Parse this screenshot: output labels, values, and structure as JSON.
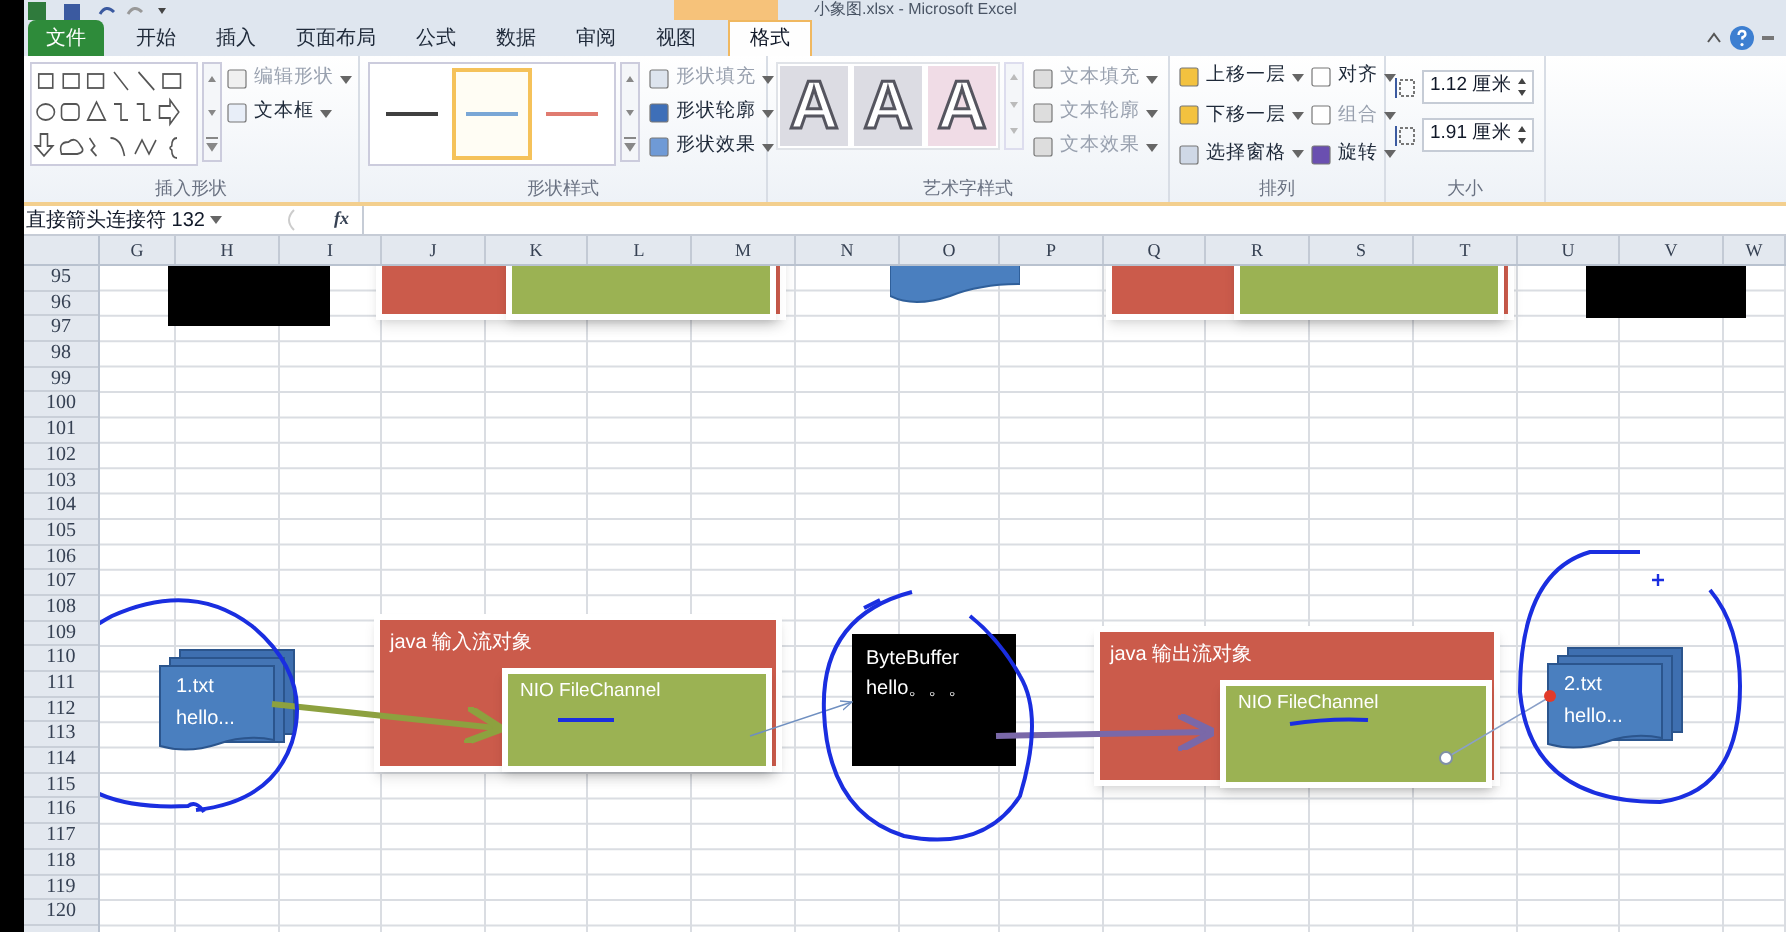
{
  "window": {
    "title": "小象图.xlsx - Microsoft Excel"
  },
  "tabs": [
    {
      "label": "文件",
      "kind": "file",
      "selected": false
    },
    {
      "label": "开始",
      "kind": "normal",
      "selected": false
    },
    {
      "label": "插入",
      "kind": "normal",
      "selected": false
    },
    {
      "label": "页面布局",
      "kind": "normal",
      "selected": false
    },
    {
      "label": "公式",
      "kind": "normal",
      "selected": false
    },
    {
      "label": "数据",
      "kind": "normal",
      "selected": false
    },
    {
      "label": "审阅",
      "kind": "normal",
      "selected": false
    },
    {
      "label": "视图",
      "kind": "normal",
      "selected": false
    },
    {
      "label": "格式",
      "kind": "context",
      "selected": true
    }
  ],
  "insert_shapes": {
    "label": "插入形状",
    "buttons": [
      {
        "label": "编辑形状",
        "disabled": true
      },
      {
        "label": "文本框",
        "disabled": false
      }
    ]
  },
  "shape_styles": {
    "label": "形状样式",
    "presets": [
      {
        "color": "#404040",
        "selected": false
      },
      {
        "color": "#7aa7d6",
        "selected": true
      },
      {
        "color": "#e07b70",
        "selected": false
      }
    ],
    "buttons": [
      {
        "label": "形状填充",
        "disabled": true
      },
      {
        "label": "形状轮廓",
        "disabled": false
      },
      {
        "label": "形状效果",
        "disabled": false
      }
    ]
  },
  "wordart_styles": {
    "label": "艺术字样式",
    "presets": [
      {
        "label": "A"
      },
      {
        "label": "A"
      },
      {
        "label": "A"
      }
    ],
    "buttons": [
      {
        "label": "文本填充",
        "disabled": true
      },
      {
        "label": "文本轮廓",
        "disabled": true
      },
      {
        "label": "文本效果",
        "disabled": true
      }
    ]
  },
  "arrange": {
    "label": "排列",
    "buttons": [
      {
        "label": "上移一层",
        "disabled": false
      },
      {
        "label": "下移一层",
        "disabled": false
      },
      {
        "label": "选择窗格",
        "disabled": false
      },
      {
        "label": "对齐",
        "disabled": false
      },
      {
        "label": "组合",
        "disabled": true
      },
      {
        "label": "旋转",
        "disabled": false
      }
    ]
  },
  "size": {
    "label": "大小",
    "fields": [
      {
        "value": "1.12 厘米"
      },
      {
        "value": "1.91 厘米"
      }
    ]
  },
  "formula_bar": {
    "name_box": "直接箭头连接符 132",
    "function_button": "fx"
  },
  "sheet": {
    "columns": [
      "G",
      "H",
      "I",
      "J",
      "K",
      "L",
      "M",
      "N",
      "O",
      "P",
      "Q",
      "R",
      "S",
      "T",
      "U",
      "V",
      "W"
    ],
    "rows": [
      "95",
      "96",
      "97",
      "98",
      "99",
      "100",
      "101",
      "102",
      "103",
      "104",
      "105",
      "106",
      "107",
      "108",
      "109",
      "110",
      "111",
      "112",
      "113",
      "114",
      "115",
      "116",
      "117",
      "118",
      "119",
      "120"
    ]
  },
  "diagram": {
    "nodes": [
      {
        "kind": "black"
      },
      {
        "kind": "red"
      },
      {
        "kind": "green"
      },
      {
        "kind": "wave"
      },
      {
        "kind": "red"
      },
      {
        "kind": "green"
      },
      {
        "kind": "black"
      },
      {
        "kind": "document",
        "lines": [
          "1.txt",
          "hello..."
        ]
      },
      {
        "kind": "red",
        "lines": [
          "java  输入流对象"
        ]
      },
      {
        "kind": "green",
        "lines": [
          "NIO FileChannel"
        ]
      },
      {
        "kind": "black",
        "lines": [
          "ByteBuffer",
          "hello。。。"
        ]
      },
      {
        "kind": "red",
        "lines": [
          "java  输出流对象"
        ]
      },
      {
        "kind": "green",
        "lines": [
          "NIO FileChannel"
        ]
      },
      {
        "kind": "document",
        "lines": [
          "2.txt",
          "hello..."
        ]
      }
    ]
  }
}
